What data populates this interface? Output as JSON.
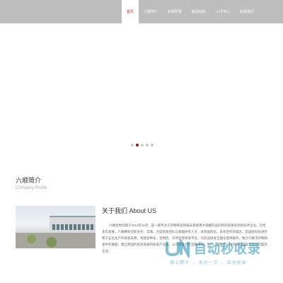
{
  "nav": {
    "items": [
      {
        "label": "首页",
        "active": true
      },
      {
        "label": "六顺简介",
        "active": false
      },
      {
        "label": "科技研发",
        "active": false
      },
      {
        "label": "新闻动态",
        "active": false
      },
      {
        "label": "人才中心",
        "active": false
      },
      {
        "label": "联系我们",
        "active": false
      }
    ]
  },
  "slider": {
    "slide_count": 5,
    "active_index": 1
  },
  "company_profile": {
    "title": "六顺简介",
    "subtitle": "Company Profile"
  },
  "about": {
    "title": "关于我们 About US",
    "text": "六顺生物创建于2013年11月，是一家专注于药物筛选和临床系统用大规模药品的新药研发的高新技术企业。历经多年发展，六顺拥有创新主导、实践、大型研发团队与基础研究人才，具有国际化、具有合作的理念，是国际科技进步和工业化生产的研发支撑，构建多种化、生物药、天然药等研发平台，为药品研发全面化提供服务，致力于解决药物研发中的难题，建立跨国的高效发展的研发产业链。公司将着力打造集研发、生产、销售于一体的具有国际竞争力的医药企业。"
  },
  "watermark": {
    "brand": "自动秒收录",
    "slogan": "做上精华 → 未达一次 → 自动收录"
  },
  "colors": {
    "topbar": "#bdbdbd",
    "active_nav_text": "#c21f1f",
    "active_dot": "#8b1a1a"
  }
}
